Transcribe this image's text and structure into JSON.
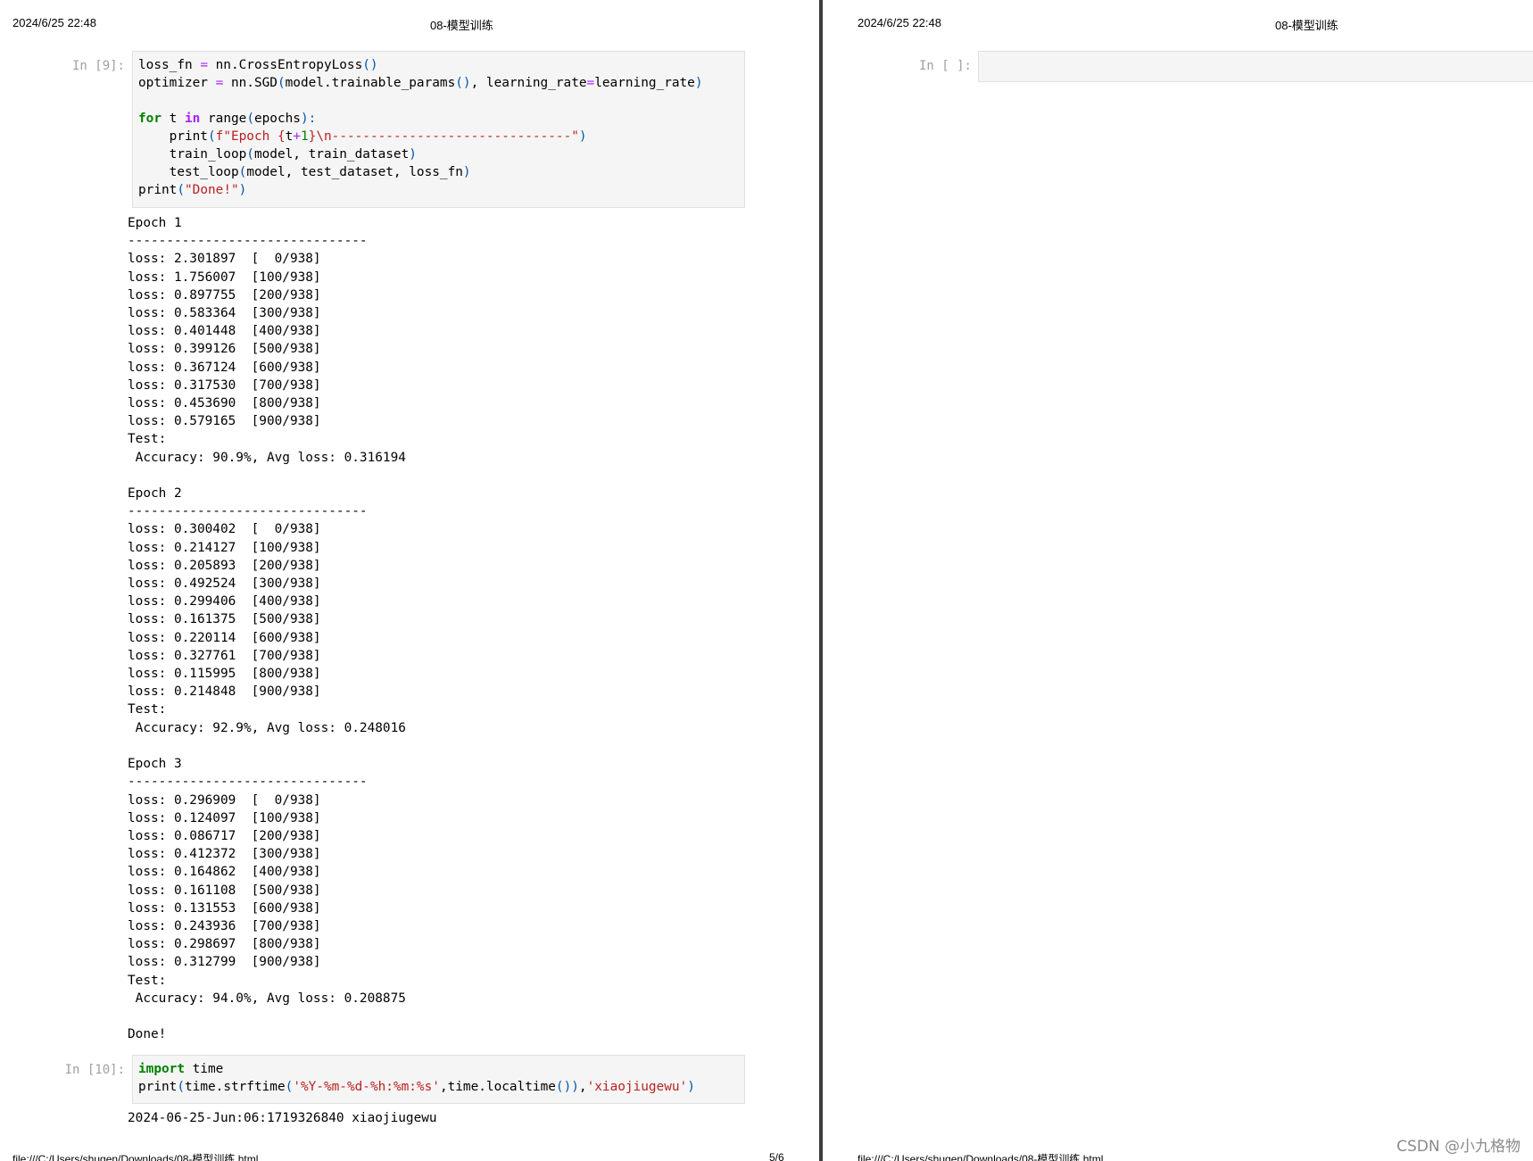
{
  "left_page": {
    "date": "2024/6/25 22:48",
    "title": "08-模型训练",
    "footer_path": "file:///C:/Users/shugen/Downloads/08-模型训练.html",
    "footer_page": "5/6",
    "cell9": {
      "prompt": "In [9]:",
      "code": {
        "l1_a": "loss_fn ",
        "l1_op": "=",
        "l1_b": " nn.CrossEntropyLoss",
        "l1_p": "()",
        "l2_a": "optimizer ",
        "l2_op": "=",
        "l2_b": " nn.SGD",
        "l2_p1": "(",
        "l2_c": "model.trainable_params",
        "l2_p2": "()",
        "l2_d": ", learning_rate",
        "l2_op2": "=",
        "l2_e": "learning_rate",
        "l2_p3": ")",
        "l4_kw": "for",
        "l4_a": " t ",
        "l4_kw2": "in",
        "l4_b": " range",
        "l4_p1": "(",
        "l4_c": "epochs",
        "l4_p2": "):",
        "l5_a": "    print",
        "l5_p1": "(",
        "l5_s1": "f\"Epoch ",
        "l5_br1": "{",
        "l5_t": "t",
        "l5_op": "+",
        "l5_n": "1",
        "l5_br2": "}",
        "l5_s2": "\\n-------------------------------\"",
        "l5_p2": ")",
        "l6_a": "    train_loop",
        "l6_p1": "(",
        "l6_b": "model, train_dataset",
        "l6_p2": ")",
        "l7_a": "    test_loop",
        "l7_p1": "(",
        "l7_b": "model, test_dataset, loss_fn",
        "l7_p2": ")",
        "l8_a": "print",
        "l8_p1": "(",
        "l8_s": "\"Done!\"",
        "l8_p2": ")"
      },
      "output": "Epoch 1\n-------------------------------\nloss: 2.301897  [  0/938]\nloss: 1.756007  [100/938]\nloss: 0.897755  [200/938]\nloss: 0.583364  [300/938]\nloss: 0.401448  [400/938]\nloss: 0.399126  [500/938]\nloss: 0.367124  [600/938]\nloss: 0.317530  [700/938]\nloss: 0.453690  [800/938]\nloss: 0.579165  [900/938]\nTest:\n Accuracy: 90.9%, Avg loss: 0.316194\n\nEpoch 2\n-------------------------------\nloss: 0.300402  [  0/938]\nloss: 0.214127  [100/938]\nloss: 0.205893  [200/938]\nloss: 0.492524  [300/938]\nloss: 0.299406  [400/938]\nloss: 0.161375  [500/938]\nloss: 0.220114  [600/938]\nloss: 0.327761  [700/938]\nloss: 0.115995  [800/938]\nloss: 0.214848  [900/938]\nTest:\n Accuracy: 92.9%, Avg loss: 0.248016\n\nEpoch 3\n-------------------------------\nloss: 0.296909  [  0/938]\nloss: 0.124097  [100/938]\nloss: 0.086717  [200/938]\nloss: 0.412372  [300/938]\nloss: 0.164862  [400/938]\nloss: 0.161108  [500/938]\nloss: 0.131553  [600/938]\nloss: 0.243936  [700/938]\nloss: 0.298697  [800/938]\nloss: 0.312799  [900/938]\nTest:\n Accuracy: 94.0%, Avg loss: 0.208875\n\nDone!"
    },
    "cell10": {
      "prompt": "In [10]:",
      "code": {
        "l1_kw": "import",
        "l1_a": " time",
        "l2_a": "print",
        "l2_p1": "(",
        "l2_b": "time.strftime",
        "l2_p2": "(",
        "l2_s1": "'%Y-%m-%d-%h:%m:%s'",
        "l2_c": ",time.localtime",
        "l2_p3": "())",
        "l2_d": ",",
        "l2_s2": "'xiaojiugewu'",
        "l2_p4": ")"
      },
      "output": "2024-06-25-Jun:06:1719326840 xiaojiugewu"
    }
  },
  "right_page": {
    "date": "2024/6/25 22:48",
    "title": "08-模型训练",
    "footer_path": "file:///C:/Users/shugen/Downloads/08-模型训练.html",
    "empty_cell": {
      "prompt": "In [ ]:"
    }
  },
  "watermark": "CSDN @小九格物"
}
